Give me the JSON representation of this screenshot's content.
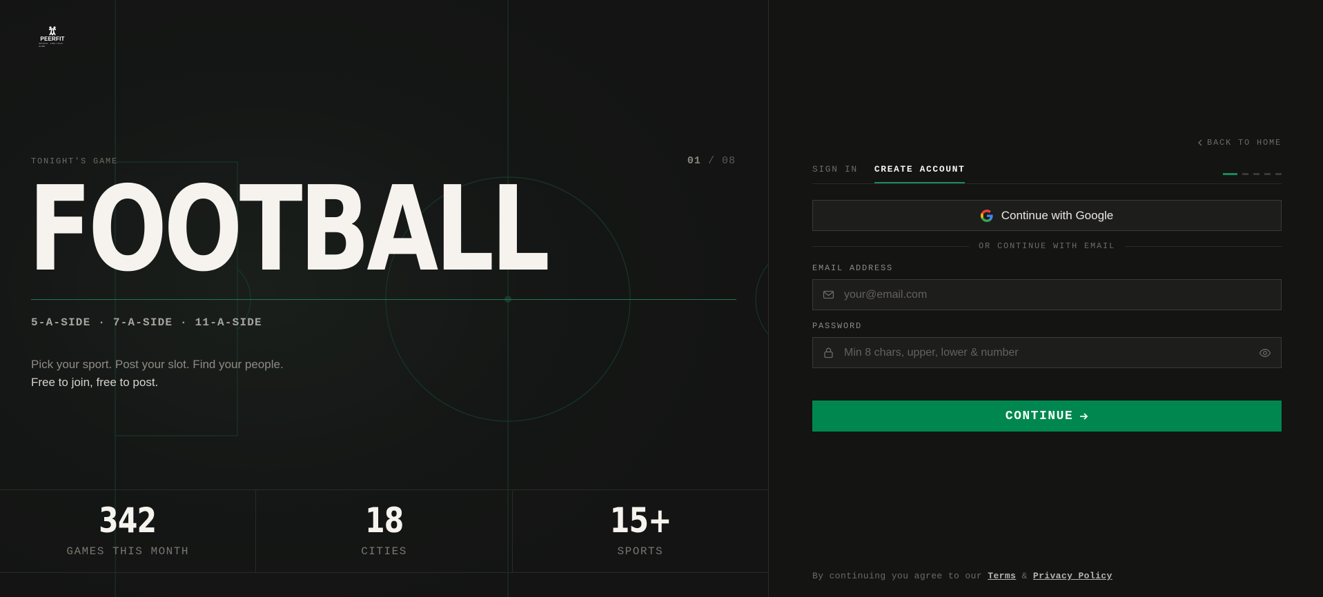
{
  "brand": {
    "name": "PEERFIT",
    "tagline": "SPORTS · FIND YOUR GAME"
  },
  "hero": {
    "eyebrow": "TONIGHT'S GAME",
    "counter_current": "01",
    "counter_sep": "/",
    "counter_total": "08",
    "sport": "FOOTBALL",
    "formats": "5-A-SIDE · 7-A-SIDE · 11-A-SIDE",
    "tagline_line1": "Pick your sport. Post your slot. Find your people.",
    "tagline_line2": "Free to join, free to post."
  },
  "stats": [
    {
      "value": "342",
      "label": "GAMES THIS MONTH"
    },
    {
      "value": "18",
      "label": "CITIES"
    },
    {
      "value": "15+",
      "label": "SPORTS"
    }
  ],
  "auth": {
    "back_label": "BACK TO HOME",
    "tabs": [
      {
        "label": "SIGN IN",
        "active": false
      },
      {
        "label": "CREATE ACCOUNT",
        "active": true
      }
    ],
    "steps_total": 5,
    "steps_current": 1,
    "google_label": "Continue with Google",
    "divider_label": "OR CONTINUE WITH EMAIL",
    "email_label": "EMAIL ADDRESS",
    "email_placeholder": "your@email.com",
    "password_label": "PASSWORD",
    "password_placeholder": "Min 8 chars, upper, lower & number",
    "continue_label": "CONTINUE",
    "legal_prefix": "By continuing you agree to our",
    "legal_terms": "Terms",
    "legal_amp": "&",
    "legal_privacy": "Privacy Policy"
  },
  "colors": {
    "accent": "#00874f",
    "accent_line": "#1a8a58",
    "background": "#141413",
    "text": "#f6f3ee"
  }
}
